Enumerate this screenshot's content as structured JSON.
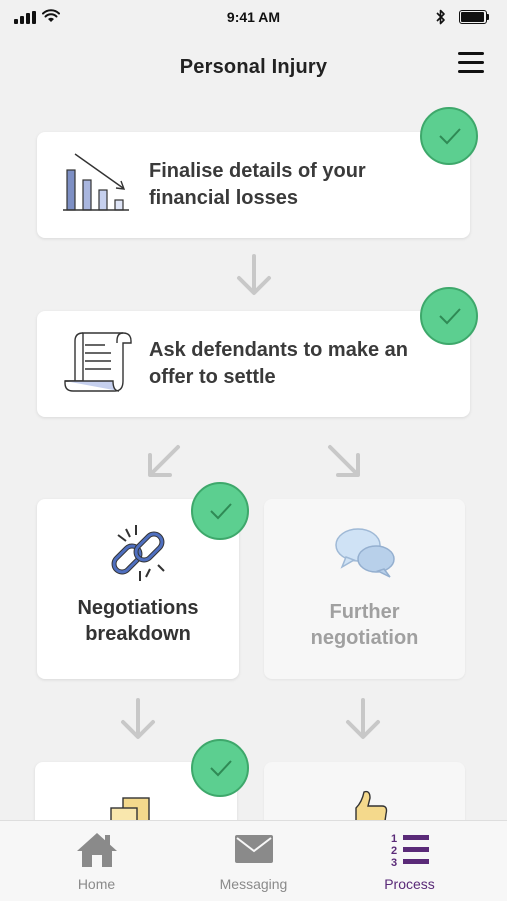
{
  "status_bar": {
    "time": "9:41 AM"
  },
  "nav": {
    "title": "Personal Injury",
    "menu_icon": "hamburger-menu-icon"
  },
  "steps": [
    {
      "label": "Finalise details of your financial losses",
      "icon": "declining-chart-icon",
      "completed": true
    },
    {
      "label": "Ask defendants to make an offer to settle",
      "icon": "scroll-document-icon",
      "completed": true
    },
    {
      "label": "Negotiations breakdown",
      "icon": "broken-link-icon",
      "completed": true
    },
    {
      "label": "Further negotiation",
      "icon": "speech-bubbles-icon",
      "completed": false
    },
    {
      "label": "",
      "icon": "documents-icon",
      "completed": true
    },
    {
      "label": "",
      "icon": "thumbs-up-icon",
      "completed": false
    }
  ],
  "tabs": [
    {
      "label": "Home",
      "icon": "home-icon",
      "active": false
    },
    {
      "label": "Messaging",
      "icon": "envelope-icon",
      "active": false
    },
    {
      "label": "Process",
      "icon": "numbered-list-icon",
      "active": true
    }
  ],
  "colors": {
    "check_green": "#5ccf90",
    "accent_purple": "#5a2a78",
    "arrow_gray": "#c8c8c8"
  }
}
